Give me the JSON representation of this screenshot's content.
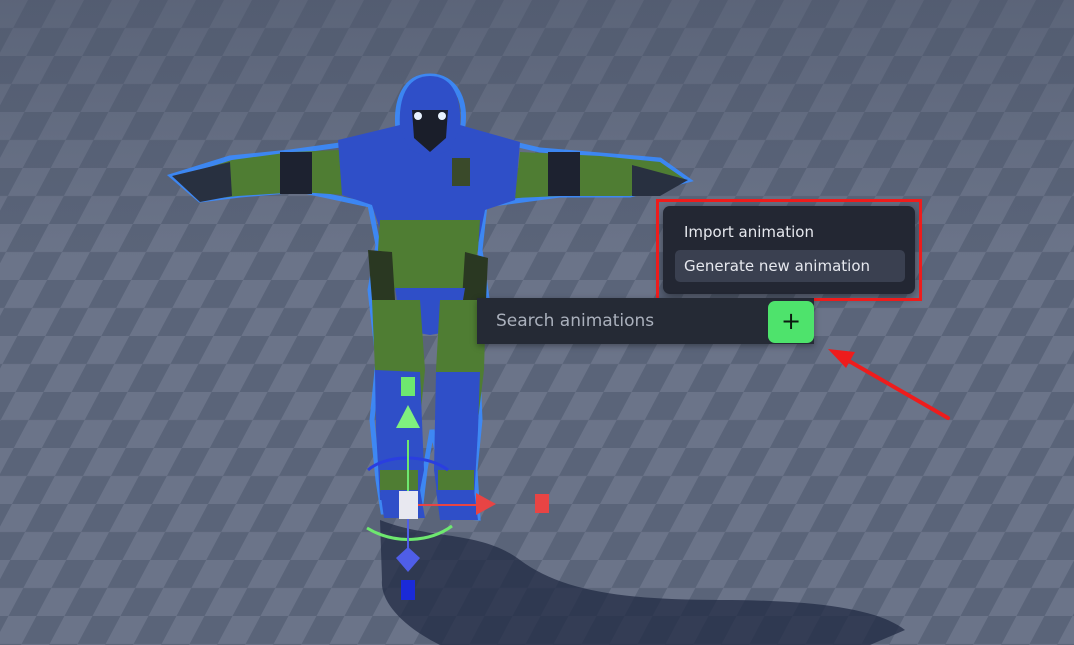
{
  "colors": {
    "floor_light": "#6b7489",
    "floor_dark": "#5a6479",
    "menu_bg": "#232733",
    "menu_active_bg": "#3a4050",
    "search_bg": "#252a35",
    "add_button": "#4ee36c",
    "highlight_red": "#ee1c1c",
    "character_blue": "#2f4fc8",
    "character_green": "#4f7d33",
    "outline": "#3a8bff"
  },
  "menu": {
    "items": [
      {
        "label": "Import animation"
      },
      {
        "label": "Generate new animation"
      }
    ]
  },
  "search": {
    "placeholder": "Search animations",
    "value": ""
  },
  "add_button": {
    "icon": "plus-icon",
    "glyph": "+"
  },
  "annotation": {
    "icon": "red-arrow-icon"
  }
}
